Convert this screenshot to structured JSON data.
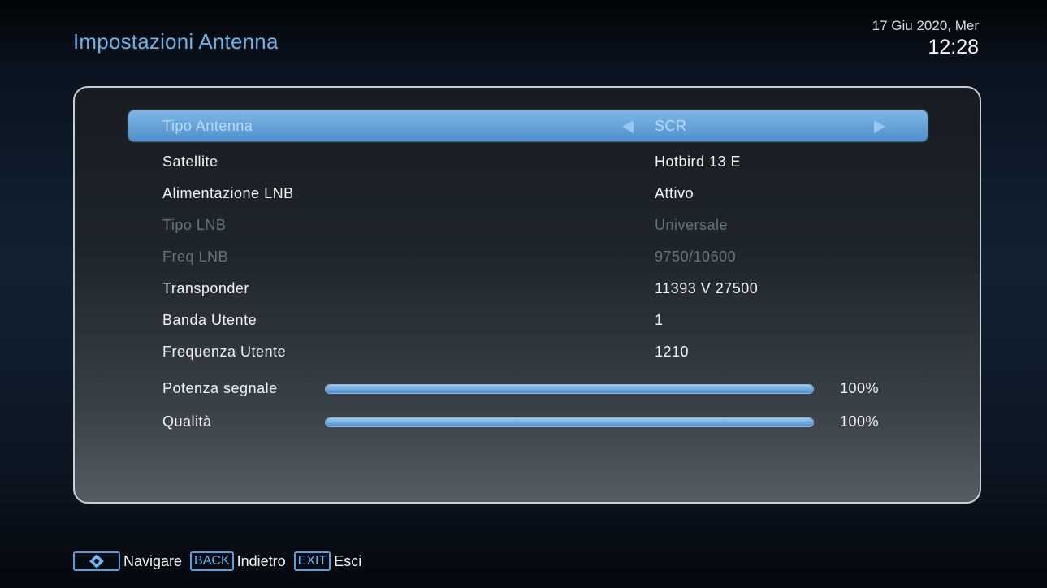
{
  "header": {
    "title": "Impostazioni Antenna",
    "date": "17 Giu 2020, Mer",
    "time": "12:28"
  },
  "settings": [
    {
      "label": "Tipo Antenna",
      "value": "SCR",
      "state": "selected"
    },
    {
      "label": "Satellite",
      "value": "Hotbird 13 E",
      "state": "normal"
    },
    {
      "label": "Alimentazione LNB",
      "value": "Attivo",
      "state": "normal"
    },
    {
      "label": "Tipo LNB",
      "value": "Universale",
      "state": "disabled"
    },
    {
      "label": "Freq LNB",
      "value": "9750/10600",
      "state": "disabled"
    },
    {
      "label": "Transponder",
      "value": "11393 V 27500",
      "state": "normal"
    },
    {
      "label": "Banda Utente",
      "value": "1",
      "state": "normal"
    },
    {
      "label": "Frequenza Utente",
      "value": "1210",
      "state": "normal"
    }
  ],
  "meters": [
    {
      "label": "Potenza segnale",
      "percent_text": "100%",
      "level": 1.0
    },
    {
      "label": "Qualità",
      "percent_text": "100%",
      "level": 1.0
    }
  ],
  "footer": {
    "navigate_label": "Navigare",
    "back_key": "BACK",
    "back_label": "Indietro",
    "exit_key": "EXIT",
    "exit_label": "Esci"
  },
  "colors": {
    "accent": "#6fb0e4",
    "selected_row": "#5f9fd9",
    "disabled_text": "#6a737c"
  },
  "icons": {
    "selected_row_left": "arrow-left-icon",
    "selected_row_right": "arrow-right-icon",
    "navigate": "dpad-icon"
  }
}
